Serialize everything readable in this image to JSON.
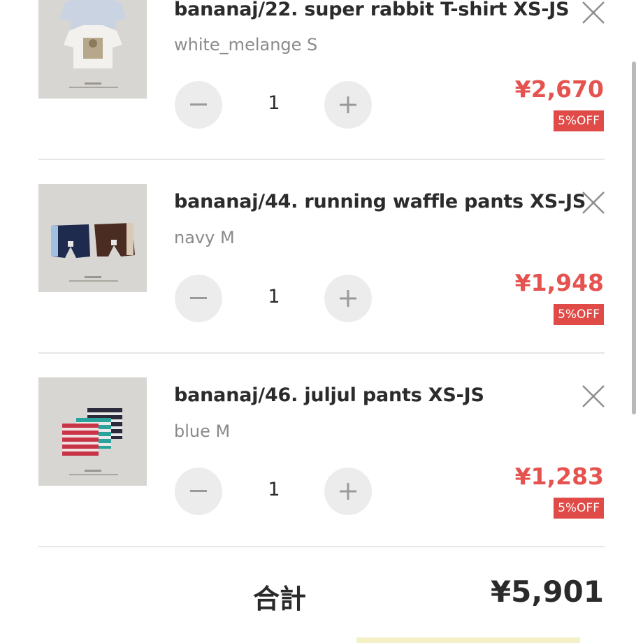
{
  "cart": {
    "items": [
      {
        "title": "bananaj/22. super rabbit T-shirt XS-JS",
        "variant": "white_melange S",
        "quantity": "1",
        "price": "¥2,670",
        "discount_badge": "5%OFF",
        "image_icon": "tshirt-product-photo"
      },
      {
        "title": "bananaj/44. running waffle pants XS-JS",
        "variant": "navy M",
        "quantity": "1",
        "price": "¥1,948",
        "discount_badge": "5%OFF",
        "image_icon": "shorts-product-photo"
      },
      {
        "title": "bananaj/46. juljul pants XS-JS",
        "variant": "blue M",
        "quantity": "1",
        "price": "¥1,283",
        "discount_badge": "5%OFF",
        "image_icon": "striped-shorts-product-photo"
      }
    ],
    "total_label": "合計",
    "total_value": "¥5,901"
  },
  "icons": {
    "minus": "minus-icon",
    "plus": "plus-icon",
    "remove": "close-icon"
  },
  "colors": {
    "price": "#e5524f",
    "badge_bg": "#e04b48",
    "button_bg": "#ececec",
    "divider": "#e6e6e6"
  }
}
